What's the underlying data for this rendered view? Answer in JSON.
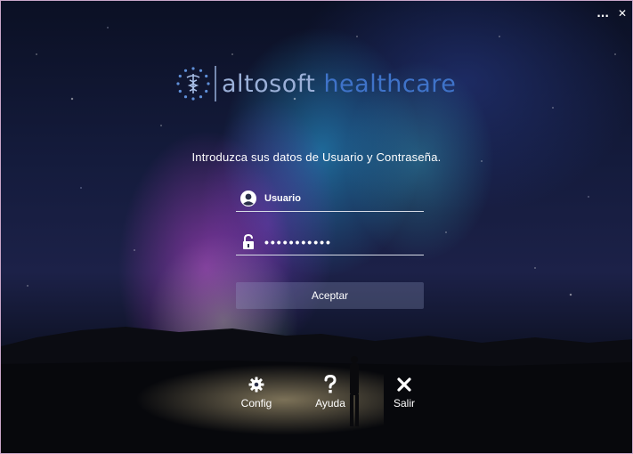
{
  "window": {
    "controls": {
      "more": "...",
      "close": "✕"
    }
  },
  "logo": {
    "word1": "altosoft",
    "word2": " healthcare"
  },
  "login": {
    "instruction": "Introduzca sus datos de Usuario y Contraseña.",
    "username_value": "Usuario",
    "password_value": "•••••••••••",
    "accept_label": "Aceptar"
  },
  "actions": {
    "config_label": "Config",
    "help_label": "Ayuda",
    "exit_label": "Salir"
  },
  "colors": {
    "logo_light": "#9bb0d8",
    "logo_accent": "#3f73c9",
    "button_bg": "rgba(150,160,200,0.28)"
  },
  "icons": {
    "user": "user-icon",
    "lock": "lock-icon",
    "config": "gear-icon",
    "help": "question-icon",
    "exit": "close-icon"
  }
}
